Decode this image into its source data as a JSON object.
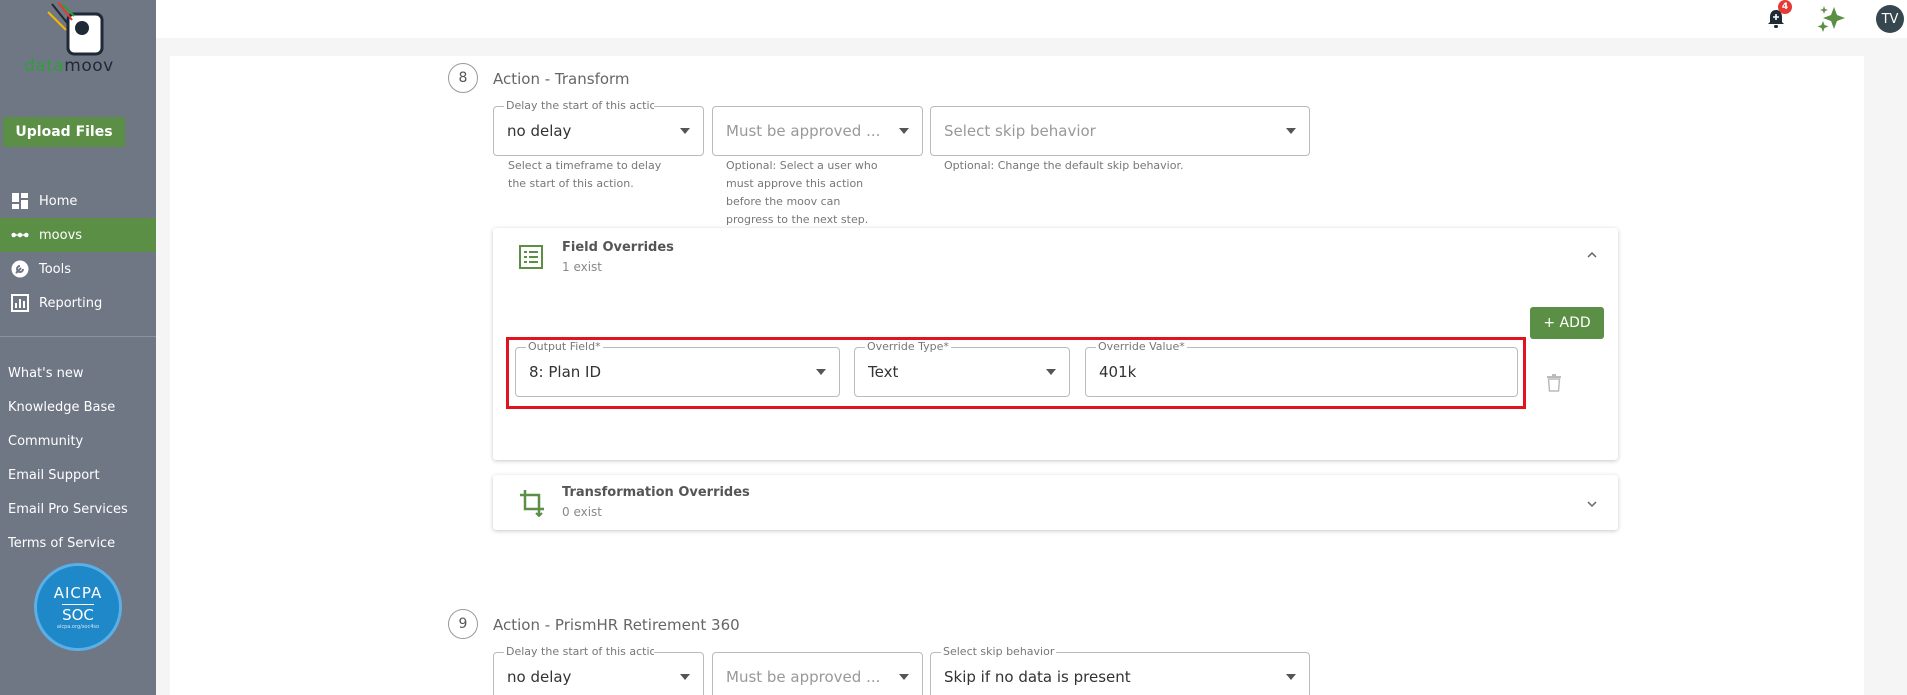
{
  "sidebar": {
    "logo": {
      "prefix": "data",
      "suffix": "moov"
    },
    "upload_label": "Upload Files",
    "nav": [
      {
        "label": "Home",
        "icon": "dashboard-icon"
      },
      {
        "label": "moovs",
        "icon": "dots-chain-icon"
      },
      {
        "label": "Tools",
        "icon": "wrench-icon"
      },
      {
        "label": "Reporting",
        "icon": "bar-chart-icon"
      }
    ],
    "links": [
      "What's new",
      "Knowledge Base",
      "Community",
      "Email Support",
      "Email Pro Services",
      "Terms of Service"
    ],
    "badge": {
      "top": "AICPA",
      "bottom": "SOC",
      "fine": "aicpa.org/soc4so"
    }
  },
  "topbar": {
    "notification_count": "4",
    "avatar_initials": "TV"
  },
  "step8": {
    "number": "8",
    "title": "Action - Transform",
    "delay": {
      "label": "Delay the start of this actio",
      "value": "no delay",
      "helper": [
        "Select a timeframe to delay",
        "the start of this action."
      ]
    },
    "approver": {
      "placeholder": "Must be approved ...",
      "helper": [
        "Optional: Select a user who",
        "must approve this action",
        "before the moov can",
        "progress to the next step."
      ]
    },
    "skip": {
      "placeholder": "Select skip behavior",
      "helper": [
        "Optional: Change the default skip behavior."
      ]
    },
    "field_overrides": {
      "title": "Field Overrides",
      "count": "1 exist",
      "add_label": "+ ADD",
      "row": {
        "output_field": {
          "label": "Output Field*",
          "value": "8: Plan ID"
        },
        "override_type": {
          "label": "Override Type*",
          "value": "Text"
        },
        "override_value": {
          "label": "Override Value*",
          "value": "401k"
        }
      }
    },
    "transformation_overrides": {
      "title": "Transformation Overrides",
      "count": "0 exist"
    }
  },
  "step9": {
    "number": "9",
    "title": "Action - PrismHR Retirement 360",
    "delay": {
      "label": "Delay the start of this actio",
      "value": "no delay"
    },
    "approver": {
      "placeholder": "Must be approved ..."
    },
    "skip": {
      "label": "Select skip behavior",
      "value": "Skip if no data is present"
    }
  },
  "colors": {
    "brand_green": "#5b8f45",
    "sidebar": "#6f7785",
    "highlight": "#e0141e",
    "badge_red": "#e53935"
  }
}
